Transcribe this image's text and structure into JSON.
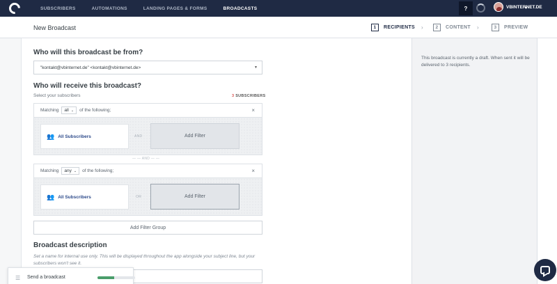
{
  "nav": {
    "links": [
      "SUBSCRIBERS",
      "AUTOMATIONS",
      "LANDING PAGES & FORMS",
      "BROADCASTS"
    ],
    "active_index": 3,
    "help_label": "?",
    "account": "VBINTERNET.DE"
  },
  "header": {
    "title": "New Broadcast",
    "steps": [
      {
        "num": "1",
        "label": "RECIPIENTS"
      },
      {
        "num": "2",
        "label": "CONTENT"
      },
      {
        "num": "3",
        "label": "PREVIEW"
      }
    ]
  },
  "form": {
    "from_title": "Who will this broadcast be from?",
    "from_value": "\"kontakt@vbinternet.de\" <kontakt@vbinternet.de>",
    "receive_title": "Who will receive this broadcast?",
    "select_label": "Select your subscribers",
    "subscriber_count": "3",
    "subscriber_count_label": "SUBSCRIBERS",
    "groups": [
      {
        "prefix": "Matching",
        "match": "all",
        "suffix": "of the following;",
        "filter_label": "All Subscribers",
        "joiner": "AND",
        "add_filter": "Add Filter"
      },
      {
        "prefix": "Matching",
        "match": "any",
        "suffix": "of the following;",
        "filter_label": "All Subscribers",
        "joiner": "OR",
        "add_filter": "Add Filter"
      }
    ],
    "group_divider": "AND",
    "add_filter_group": "Add Filter Group",
    "desc_title": "Broadcast description",
    "desc_help": "Set a name for internal use only. This will be displayed throughout the app alongside your subject line, but your subscribers won't see it."
  },
  "sidebar": {
    "note": "This broadcast is currently a draft. When sent it will be delivered to 3 recipients."
  },
  "toast": {
    "label": "Send a broadcast",
    "progress": 0.45
  },
  "colors": {
    "nav_bg": "#1f2a44",
    "progress_fill": "#4a9d6a",
    "count_accent": "#d9534f"
  }
}
